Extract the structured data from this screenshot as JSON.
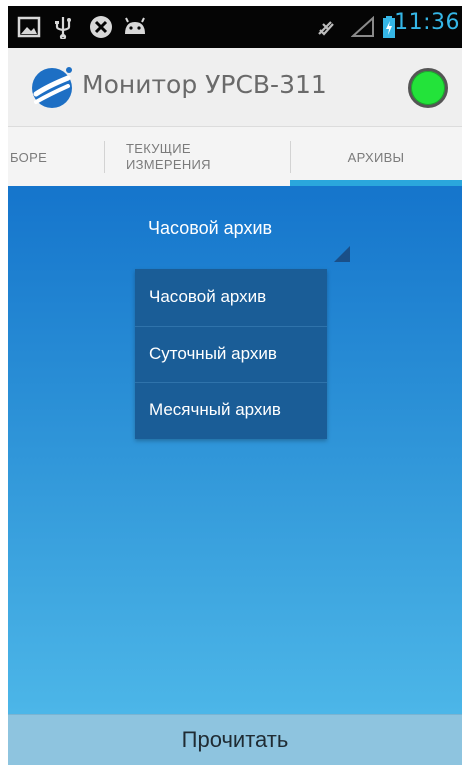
{
  "status_bar": {
    "time": "11:36",
    "icons": [
      "image-icon",
      "usb-icon",
      "blocked-icon",
      "android-icon",
      "no-sound-icon",
      "signal-icon",
      "battery-charging-icon"
    ],
    "time_color": "#35b6e6"
  },
  "action_bar": {
    "title": "Монитор УРСВ-311",
    "status_color": "#23e33a"
  },
  "tabs": [
    {
      "label": "БОРЕ",
      "selected": false
    },
    {
      "label_line1": "ТЕКУЩИЕ",
      "label_line2": "ИЗМЕРЕНИЯ",
      "selected": false
    },
    {
      "label": "АРХИВЫ",
      "selected": true
    }
  ],
  "accent_color": "#2aa6dc",
  "archive_selector": {
    "selected": "Часовой архив",
    "options": [
      "Часовой архив",
      "Суточный архив",
      "Месячный архив"
    ]
  },
  "read_button": {
    "label": "Прочитать"
  }
}
